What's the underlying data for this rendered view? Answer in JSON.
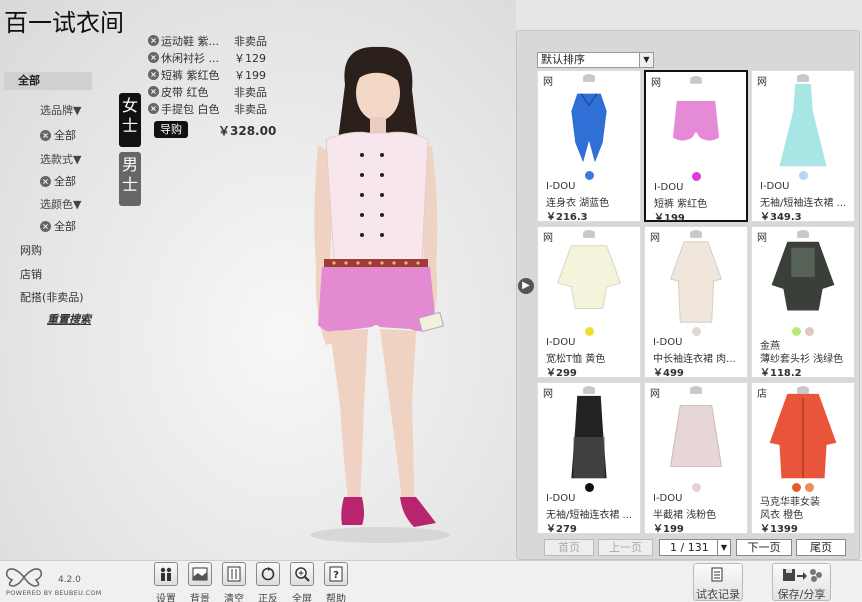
{
  "app": {
    "title": "百一试衣间"
  },
  "filters": {
    "all_label": "全部",
    "brand_label": "选品牌▼",
    "style_label": "选款式▼",
    "color_label": "选颜色▼",
    "chip_all": "全部",
    "online_label": "网购",
    "store_label": "店销",
    "mix_label": "配搭(非卖品)",
    "reset_label": "重置搜索"
  },
  "gender": {
    "women": "女士",
    "men": "男士"
  },
  "outfit": {
    "items": [
      {
        "name": "运动鞋 紫...",
        "price": "非卖品"
      },
      {
        "name": "休闲衬衫 ...",
        "price": "￥129"
      },
      {
        "name": "短裤 紫红色",
        "price": "￥199"
      },
      {
        "name": "皮带 红色",
        "price": "非卖品"
      },
      {
        "name": "手提包 白色",
        "price": "非卖品"
      }
    ],
    "guide_label": "导购",
    "total": "￥328.00"
  },
  "panel": {
    "sort_label": "默认排序",
    "products": [
      {
        "source": "网",
        "brand": "I-DOU",
        "name": "连身衣 湖蓝色",
        "price": "￥216.3",
        "swatches": [
          "#3a7ad8"
        ],
        "garment": "romper",
        "color": "#2f6fd6"
      },
      {
        "source": "网",
        "brand": "I-DOU",
        "name": "短裤 紫红色",
        "price": "￥199",
        "swatches": [
          "#e03ad8"
        ],
        "garment": "shorts",
        "color": "#e58ad6"
      },
      {
        "source": "网",
        "brand": "I-DOU",
        "name": "无袖/短袖连衣裙 ...",
        "price": "￥349.3",
        "swatches": [
          "#b8d6f0"
        ],
        "garment": "dress",
        "color": "#a8e6e6"
      },
      {
        "source": "网",
        "brand": "I-DOU",
        "name": "宽松T恤 黄色",
        "price": "￥299",
        "swatches": [
          "#f0e030"
        ],
        "garment": "top",
        "color": "#f4f4dc"
      },
      {
        "source": "网",
        "brand": "I-DOU",
        "name": "中长袖连衣裙 肉...",
        "price": "￥499",
        "swatches": [
          "#e0d8d0"
        ],
        "garment": "dress-long",
        "color": "#f0e6dc"
      },
      {
        "source": "网",
        "brand": "金燕",
        "name": "薄纱套头衫 浅绿色",
        "price": "￥118.2",
        "swatches": [
          "#b8e87a",
          "#e0c8c8"
        ],
        "garment": "blouse",
        "color": "#3a3f3a"
      },
      {
        "source": "网",
        "brand": "I-DOU",
        "name": "无袖/短袖连衣裙 ...",
        "price": "￥279",
        "swatches": [
          "#111111"
        ],
        "garment": "dress-dark",
        "color": "#222222"
      },
      {
        "source": "网",
        "brand": "I-DOU",
        "name": "半截裙 浅粉色",
        "price": "￥199",
        "swatches": [
          "#e8d0d8"
        ],
        "garment": "skirt",
        "color": "#e6d6d6"
      },
      {
        "source": "店",
        "brand": "马克华菲女装",
        "name": "风衣 橙色",
        "price": "￥1399",
        "swatches": [
          "#e85a30",
          "#f08a50"
        ],
        "garment": "coat",
        "color": "#e8553a"
      }
    ],
    "pagination": {
      "first": "首页",
      "prev": "上一页",
      "page": "1 / 131",
      "next": "下一页",
      "last": "尾页"
    }
  },
  "toolbar": {
    "settings": "设置",
    "background": "背景",
    "clear": "清空",
    "flip": "正反",
    "fullscreen": "全屏",
    "help": "帮助",
    "history": "试衣记录",
    "save_share": "保存/分享"
  },
  "logo": {
    "version": "4.2.0",
    "powered": "POWERED BY BEUBEU.COM"
  }
}
